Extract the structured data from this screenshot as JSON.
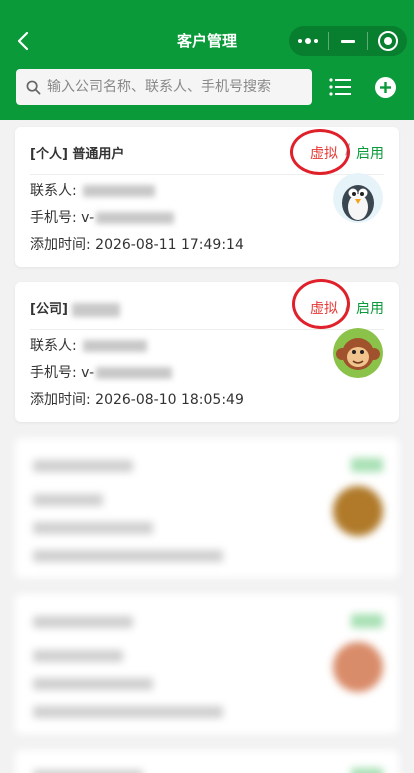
{
  "header": {
    "title": "客户管理",
    "back_icon": "chevron-left-icon",
    "capsule": {
      "more_icon": "more-dots-icon",
      "minimize_icon": "minimize-icon",
      "close_icon": "target-icon"
    }
  },
  "search": {
    "placeholder": "输入公司名称、联系人、手机号搜索",
    "value": "",
    "icon": "search-icon"
  },
  "toolbar": {
    "list_icon": "list-icon",
    "add_icon": "add-icon"
  },
  "colors": {
    "primary": "#0a9a3a",
    "danger": "#e53935",
    "annotation": "#e0202a"
  },
  "customers": [
    {
      "title": "[个人] 普通用户",
      "virtual_label": "虚拟",
      "separator": "/",
      "enable_label": "启用",
      "contact_label": "联系人:",
      "phone_label": "手机号:",
      "phone_value": "v-",
      "added_label": "添加时间:",
      "added_value": "2026-08-11 17:49:14",
      "avatar_icon": "penguin-avatar"
    },
    {
      "title": "[公司]",
      "virtual_label": "虚拟",
      "separator": "/",
      "enable_label": "启用",
      "contact_label": "联系人:",
      "phone_label": "手机号:",
      "phone_value": "v-",
      "added_label": "添加时间:",
      "added_value": "2026-08-10 18:05:49",
      "avatar_icon": "monkey-avatar"
    }
  ]
}
